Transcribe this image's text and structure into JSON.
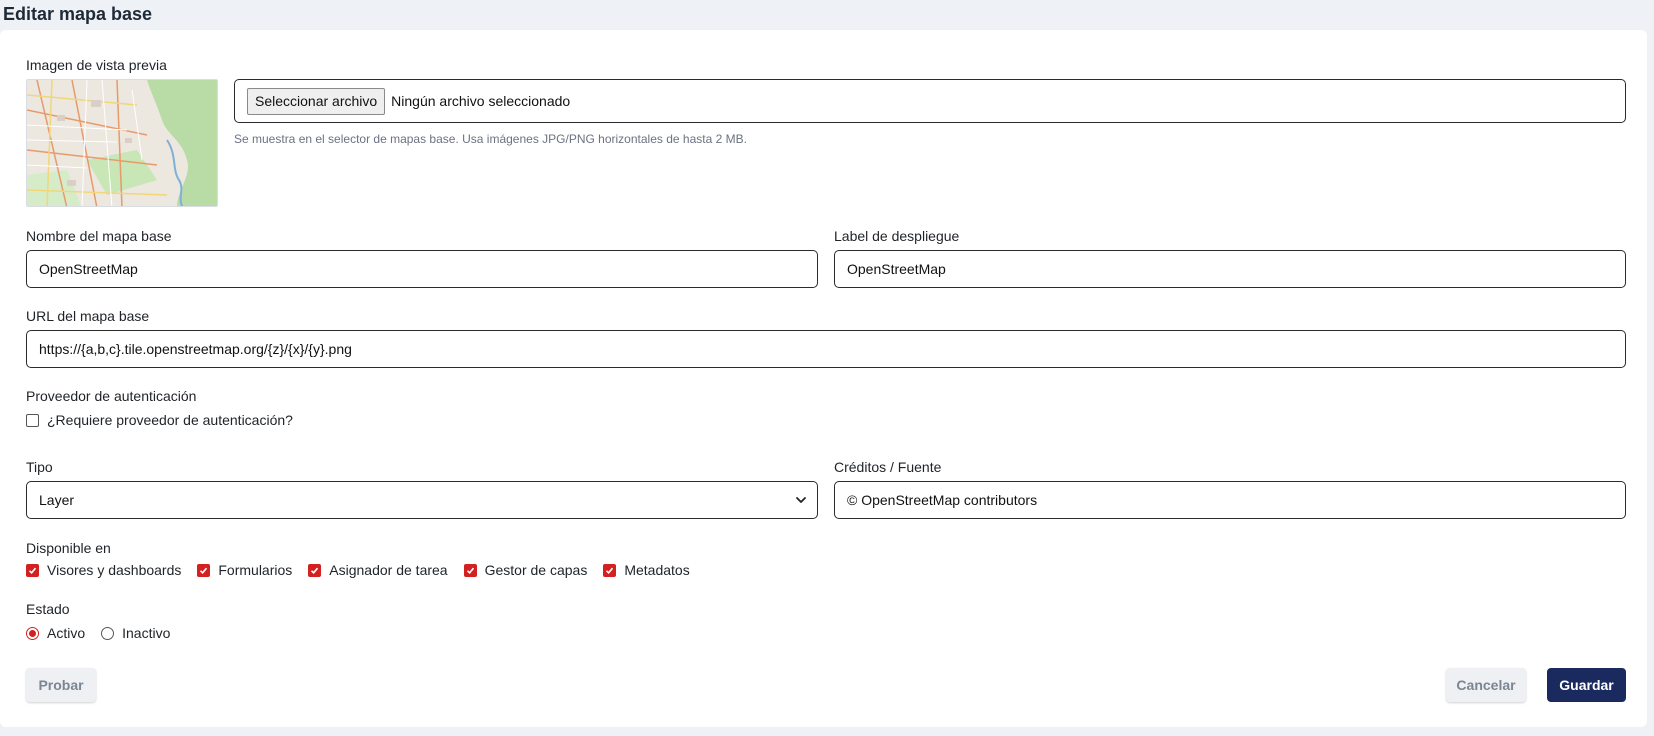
{
  "page": {
    "title": "Editar mapa base"
  },
  "preview": {
    "label": "Imagen de vista previa",
    "file_button": "Seleccionar archivo",
    "file_status": "Ningún archivo seleccionado",
    "help": "Se muestra en el selector de mapas base. Usa imágenes JPG/PNG horizontales de hasta 2 MB."
  },
  "fields": {
    "name": {
      "label": "Nombre del mapa base",
      "value": "OpenStreetMap"
    },
    "display_label": {
      "label": "Label de despliegue",
      "value": "OpenStreetMap"
    },
    "url": {
      "label": "URL del mapa base",
      "value": "https://{a,b,c}.tile.openstreetmap.org/{z}/{x}/{y}.png"
    },
    "auth": {
      "label": "Proveedor de autenticación",
      "checkbox_label": "¿Requiere proveedor de autenticación?",
      "checked": false
    },
    "type": {
      "label": "Tipo",
      "value": "Layer"
    },
    "credits": {
      "label": "Créditos / Fuente",
      "value": "© OpenStreetMap contributors"
    }
  },
  "available": {
    "label": "Disponible en",
    "options": [
      {
        "label": "Visores y dashboards",
        "checked": true
      },
      {
        "label": "Formularios",
        "checked": true
      },
      {
        "label": "Asignador de tarea",
        "checked": true
      },
      {
        "label": "Gestor de capas",
        "checked": true
      },
      {
        "label": "Metadatos",
        "checked": true
      }
    ]
  },
  "status": {
    "label": "Estado",
    "options": [
      {
        "label": "Activo",
        "selected": true
      },
      {
        "label": "Inactivo",
        "selected": false
      }
    ]
  },
  "actions": {
    "test": "Probar",
    "cancel": "Cancelar",
    "save": "Guardar"
  },
  "colors": {
    "accent": "#d32020",
    "primary": "#1a2a5e",
    "background": "#eef2f6"
  },
  "icons": {
    "select_chevron": "chevron-down-icon",
    "check": "check-icon"
  }
}
